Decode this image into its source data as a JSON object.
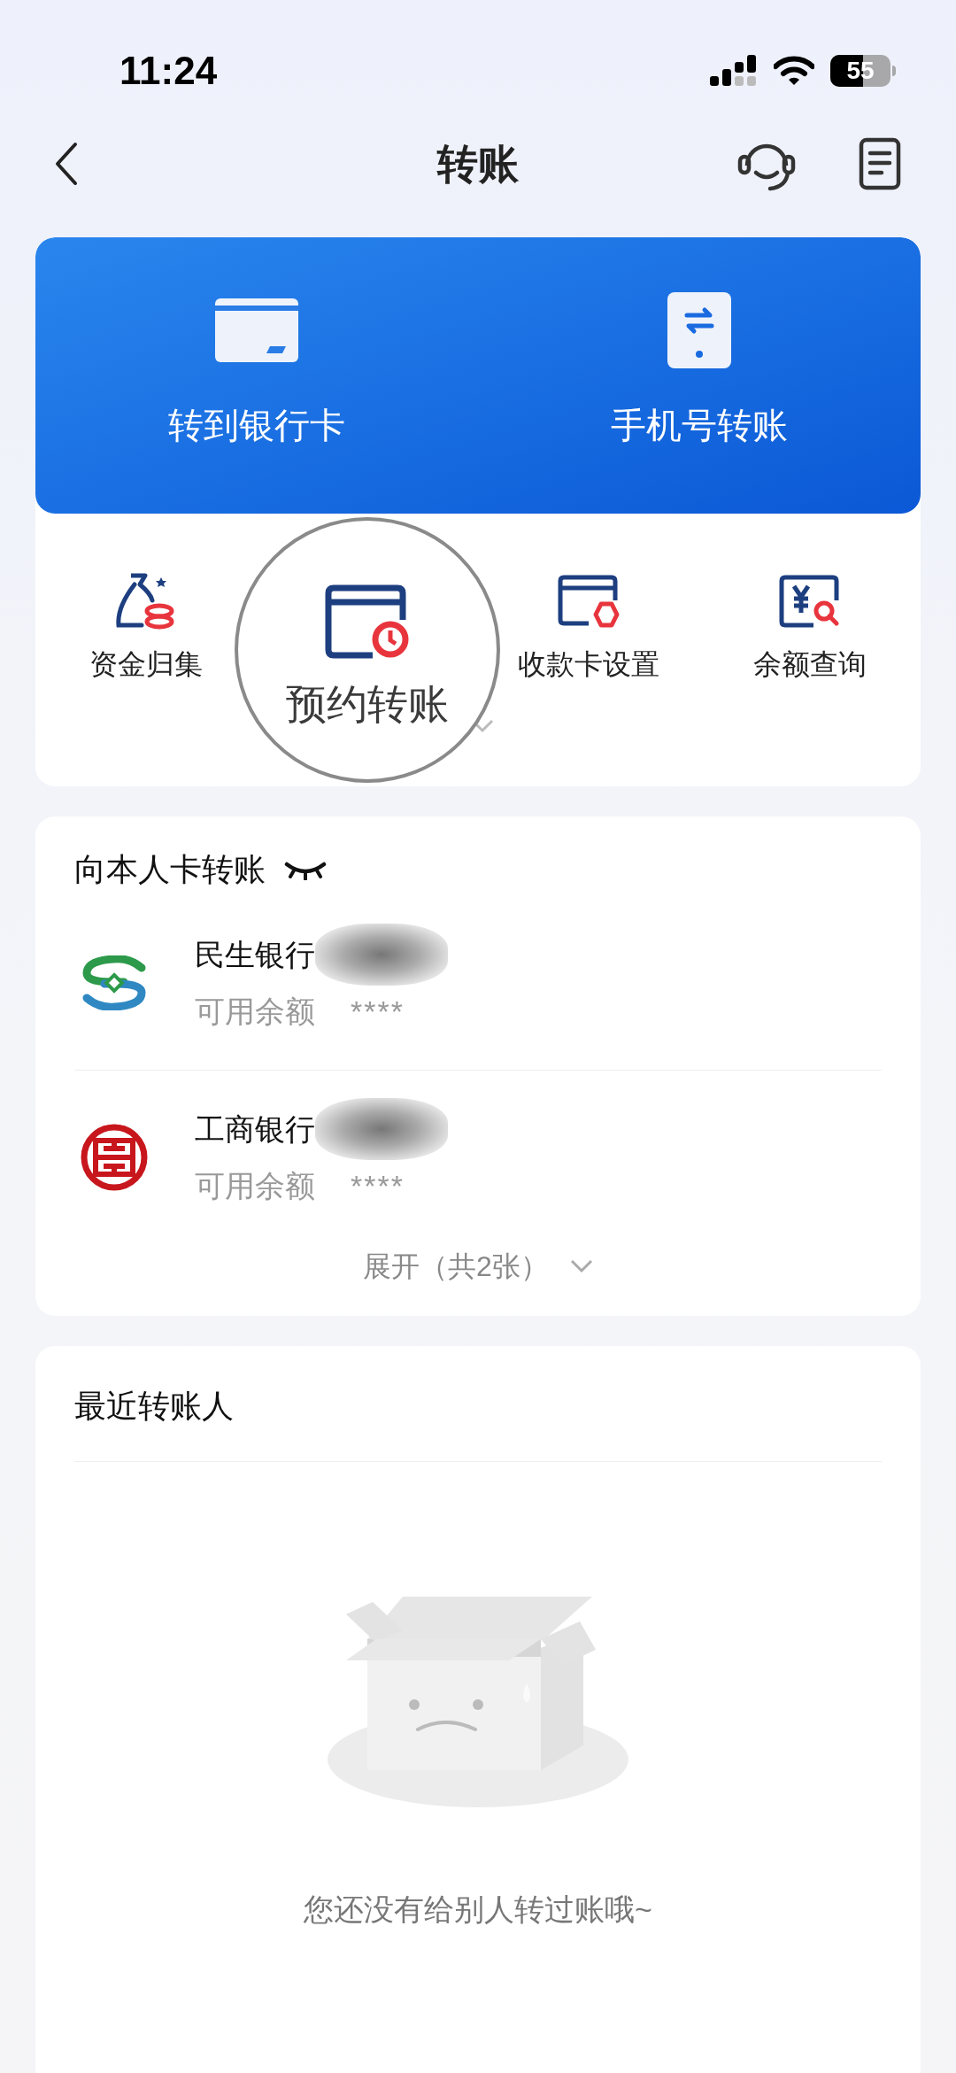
{
  "status_bar": {
    "time": "11:24",
    "battery": "55"
  },
  "nav": {
    "title": "转账"
  },
  "main_actions": [
    {
      "kind": "card",
      "label": "转到银行卡"
    },
    {
      "kind": "phone",
      "label": "手机号转账"
    }
  ],
  "quick_actions": [
    {
      "kind": "bag",
      "label": "资金归集",
      "magnified": false
    },
    {
      "kind": "clock-card",
      "label": "预约转账",
      "magnified": true
    },
    {
      "kind": "card-settings",
      "label": "收款卡设置",
      "magnified": false
    },
    {
      "kind": "balance-query",
      "label": "余额查询",
      "magnified": false
    }
  ],
  "own_cards": {
    "title": "向本人卡转账",
    "accounts": [
      {
        "kind": "cmbc",
        "name": "民生银行",
        "balance_label": "可用余额",
        "balance": "****"
      },
      {
        "kind": "icbc",
        "name": "工商银行",
        "balance_label": "可用余额",
        "balance": "****"
      }
    ],
    "expand": "展开（共2张）"
  },
  "recent": {
    "title": "最近转账人",
    "empty_message": "您还没有给别人转过账哦~"
  }
}
